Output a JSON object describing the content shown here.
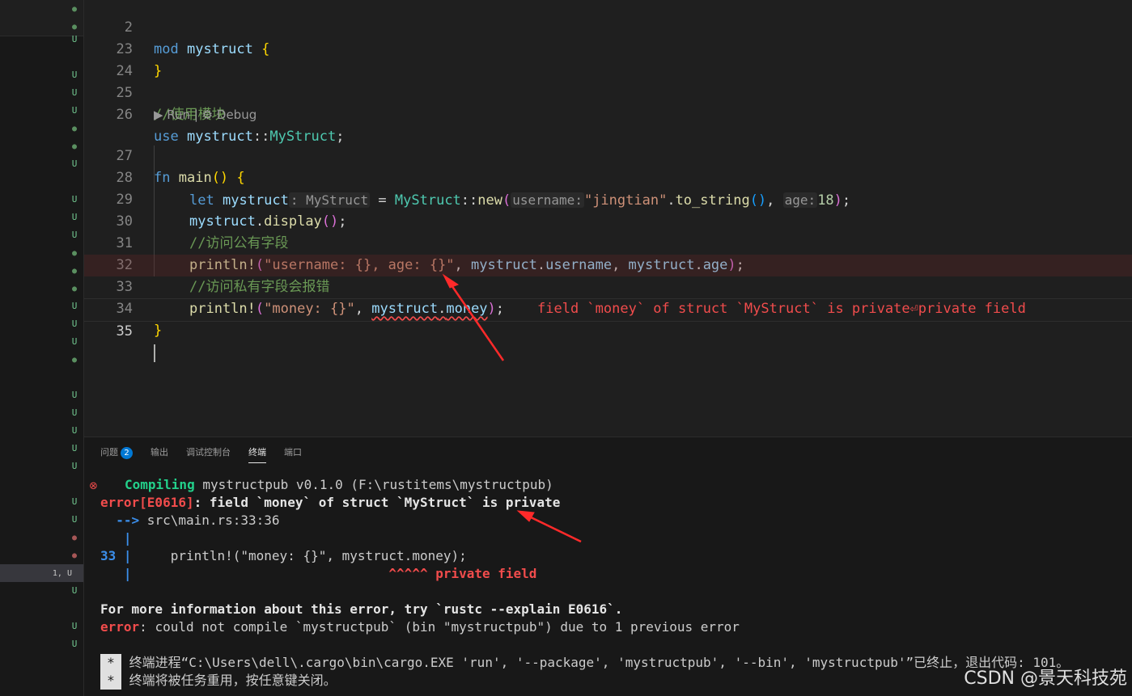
{
  "explorer": {
    "rows": [
      {
        "kind": "dot-g",
        "text": "●"
      },
      {
        "kind": "dot-g",
        "text": "●"
      },
      {
        "kind": "u",
        "text": "U"
      },
      {
        "kind": "u",
        "text": "U"
      },
      {
        "kind": "u",
        "text": "U"
      },
      {
        "kind": "u",
        "text": "U"
      },
      {
        "kind": "dot-g",
        "text": "●"
      },
      {
        "kind": "dot-g",
        "text": "●"
      },
      {
        "kind": "u",
        "text": "U"
      },
      {
        "kind": "u",
        "text": "U"
      },
      {
        "kind": "u",
        "text": "U"
      },
      {
        "kind": "u",
        "text": "U"
      },
      {
        "kind": "dot-g",
        "text": "●"
      },
      {
        "kind": "dot-g",
        "text": "●"
      },
      {
        "kind": "dot-g",
        "text": "●"
      },
      {
        "kind": "u",
        "text": "U"
      },
      {
        "kind": "u",
        "text": "U"
      },
      {
        "kind": "u",
        "text": "U"
      },
      {
        "kind": "dot-g",
        "text": "●"
      },
      {
        "kind": "u",
        "text": "U"
      },
      {
        "kind": "u",
        "text": "U"
      },
      {
        "kind": "u",
        "text": "U"
      },
      {
        "kind": "u",
        "text": "U"
      },
      {
        "kind": "u",
        "text": "U"
      },
      {
        "kind": "u",
        "text": "U"
      },
      {
        "kind": "u",
        "text": "U"
      },
      {
        "kind": "dot-r",
        "text": "●"
      },
      {
        "kind": "dot-r",
        "text": "●"
      },
      {
        "kind": "sel",
        "text": "1, U"
      },
      {
        "kind": "u",
        "text": "U"
      },
      {
        "kind": "u",
        "text": "U"
      },
      {
        "kind": "u",
        "text": "U"
      }
    ]
  },
  "editor": {
    "lines": {
      "l2": {
        "num": "2",
        "kw": "mod",
        "name": "mystruct",
        "brace": "{"
      },
      "l23": {
        "num": "23",
        "brace": "}"
      },
      "l24": {
        "num": "24"
      },
      "l25": {
        "num": "25",
        "comment": "//使用模块"
      },
      "l26": {
        "num": "26",
        "kw": "use",
        "mod": "mystruct",
        "sep": "::",
        "type": "MyStruct",
        "end": ";"
      },
      "lens": {
        "run": "▶ Run",
        "divider": " | ",
        "debug": "⚙ Debug"
      },
      "l27": {
        "num": "27",
        "kw": "fn",
        "name": "main",
        "parens": "()",
        "brace": "{"
      },
      "l28": {
        "num": "28",
        "kw": "let",
        "var": "mystruct",
        "type_hint": ": MyStruct",
        "eq": " = ",
        "type": "MyStruct",
        "sep": "::",
        "fn": "new",
        "open": "(",
        "hint_username": "username:",
        "str": "\"jingtian\"",
        "dot": ".",
        "fn2": "to_string",
        "parens": "()",
        "comma": ", ",
        "hint_age": "age:",
        "num_val": "18",
        "close": ")",
        "end": ";"
      },
      "l29": {
        "num": "29",
        "var": "mystruct",
        "dot": ".",
        "fn": "display",
        "parens": "()",
        "end": ";"
      },
      "l30": {
        "num": "30",
        "comment": "//访问公有字段"
      },
      "l31": {
        "num": "31",
        "macro": "println!",
        "open": "(",
        "str": "\"username: {}, age: {}\"",
        "comma": ", ",
        "v1": "mystruct",
        "dot1": ".",
        "f1": "username",
        "comma2": ", ",
        "v2": "mystruct",
        "dot2": ".",
        "f2": "age",
        "close": ")",
        "end": ";"
      },
      "l32": {
        "num": "32",
        "comment": "//访问私有字段会报错"
      },
      "l33": {
        "num": "33",
        "macro": "println!",
        "open": "(",
        "str": "\"money: {}\"",
        "comma": ", ",
        "v1": "mystruct",
        "dot1": ".",
        "f1": "money",
        "close": ")",
        "end": ";",
        "diagnostic": "field `money` of struct `MyStruct` is private⏎private field"
      },
      "l34": {
        "num": "34",
        "brace": "}"
      },
      "l35": {
        "num": "35"
      }
    }
  },
  "panel": {
    "tabs": [
      {
        "label": "问题",
        "badge": "2"
      },
      {
        "label": "输出"
      },
      {
        "label": "调试控制台"
      },
      {
        "label": "终端",
        "active": true
      },
      {
        "label": "端口"
      }
    ],
    "terminal": {
      "err_icon": "⊗",
      "compiling_word": "Compiling",
      "compiling_rest": " mystructpub v0.1.0 (F:\\rustitems\\mystructpub)",
      "error_code": "error[E0616]",
      "error_msg": ": field `money` of struct `MyStruct` is private",
      "arrow": "  -->",
      "location": " src\\main.rs:33:36",
      "pipe": "   |",
      "line_no": "33",
      "line_pipe": " |",
      "source": "     println!(\"money: {}\", mystruct.money);",
      "pipe3": "   |",
      "carets": "                                 ^^^^^ private field",
      "more_info": "For more information about this error, try `rustc --explain E0616`.",
      "error2_word": "error",
      "error2_msg": ": could not compile `mystructpub` (bin \"mystructpub\") due to 1 previous error",
      "star": "*",
      "proc_msg": " 终端进程“C:\\Users\\dell\\.cargo\\bin\\cargo.EXE 'run', '--package', 'mystructpub', '--bin', 'mystructpub'”已终止，退出代码: 101。",
      "reuse_msg": " 终端将被任务重用，按任意键关闭。"
    }
  },
  "watermark": "CSDN @景天科技苑"
}
